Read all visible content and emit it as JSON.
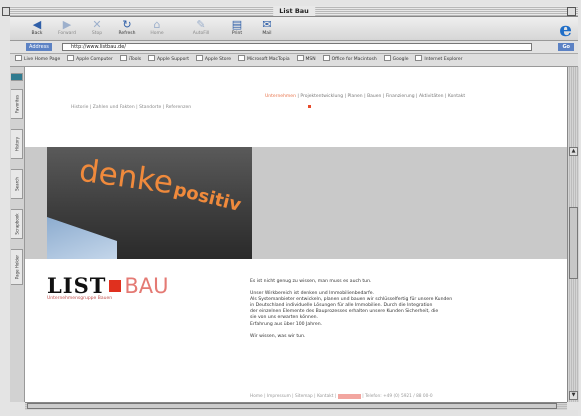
{
  "window": {
    "title": "List Bau"
  },
  "toolbar": {
    "back": "Back",
    "forward": "Forward",
    "stop": "Stop",
    "refresh": "Refresh",
    "home": "Home",
    "autofill": "AutoFill",
    "print": "Print",
    "mail": "Mail"
  },
  "address": {
    "label": "Address",
    "url": "http://www.listbau.de/",
    "go": "Go"
  },
  "favorites": [
    "Live Home Page",
    "Apple Computer",
    "iTools",
    "Apple Support",
    "Apple Store",
    "Microsoft MacTopia",
    "MSN",
    "Office for Macintosh",
    "Google",
    "Internet Explorer"
  ],
  "side_tabs": [
    "Favorites",
    "History",
    "Search",
    "Scrapbook",
    "Page Holder"
  ],
  "site": {
    "top_nav": [
      {
        "label": "Unternehmen",
        "active": true
      },
      {
        "label": "Projektentwicklung",
        "active": false
      },
      {
        "label": "Planen",
        "active": false
      },
      {
        "label": "Bauen",
        "active": false
      },
      {
        "label": "Finanzierung",
        "active": false
      },
      {
        "label": "Aktivitäten",
        "active": false
      },
      {
        "label": "Kontakt",
        "active": false
      }
    ],
    "sub_nav": [
      "Historie",
      "Zahlen und Fakten",
      "Standorte",
      "Referenzen"
    ],
    "hero_word1": "denke",
    "hero_word2": "positiv",
    "logo_list": "LIST",
    "logo_bau": "BAU",
    "tagline": "Unternehmensgruppe Bauen",
    "headline": "Es ist nicht genug zu wissen, man muss es auch tun.",
    "paragraph_lines": [
      "Unser Wirkbereich ist denken und Immobilienbedarfe.",
      "Als Systemanbieter entwickeln, planen und bauen wir schlüsselfertig für unsere Kunden",
      "in Deutschland individuelle Lösungen für alle Immobilien. Durch die Integration",
      "der einzelnen Elemente des Bauprozesses erhalten unsere Kunden Sicherheit, die",
      "sie von uns erwarten können.",
      "Erfahrung aus über 100 Jahren."
    ],
    "closing": "Wir wissen, was wir tun.",
    "footer_links": [
      "Home",
      "Impressum",
      "Sitemap",
      "Kontakt"
    ],
    "footer_phone": "Telefon: +49 (0) 5921 / 88 00-0"
  },
  "colors": {
    "accent": "#e0301e",
    "hero_text": "#f08a3c",
    "nav_highlight": "#e8734a"
  }
}
